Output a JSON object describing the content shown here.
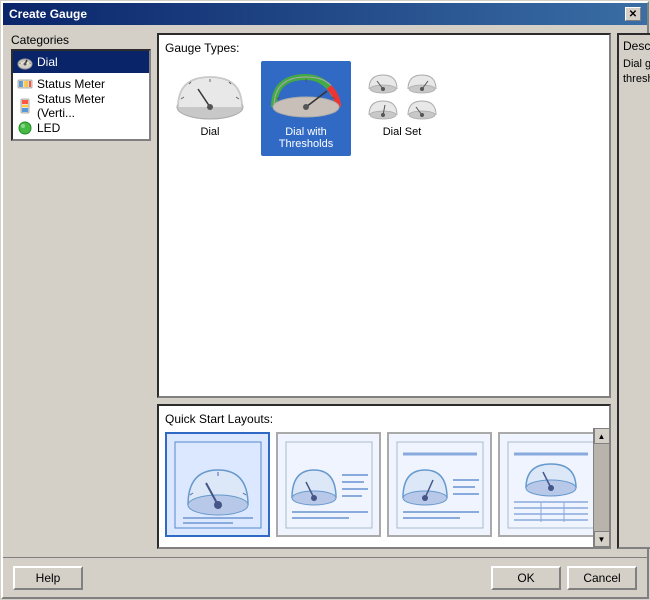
{
  "dialog": {
    "title": "Create Gauge",
    "close_btn": "✕"
  },
  "categories": {
    "label": "Categories",
    "items": [
      {
        "id": "dial",
        "label": "Dial",
        "selected": true,
        "icon": "dial"
      },
      {
        "id": "status-meter",
        "label": "Status Meter",
        "selected": false,
        "icon": "bar"
      },
      {
        "id": "status-meter-verti",
        "label": "Status Meter (Verti...",
        "selected": false,
        "icon": "bar-vert"
      },
      {
        "id": "led",
        "label": "LED",
        "selected": false,
        "icon": "circle"
      }
    ]
  },
  "gauge_types": {
    "label": "Gauge Types:",
    "items": [
      {
        "id": "dial",
        "label": "Dial",
        "selected": false
      },
      {
        "id": "dial-with-thresholds",
        "label": "Dial\nwith Thresholds",
        "selected": true
      },
      {
        "id": "dial-set",
        "label": "Dial Set",
        "selected": false
      }
    ]
  },
  "quick_start": {
    "label": "Quick Start Layouts:",
    "items": [
      {
        "id": "layout-1",
        "selected": true
      },
      {
        "id": "layout-2",
        "selected": false
      },
      {
        "id": "layout-3",
        "selected": false
      },
      {
        "id": "layout-4",
        "selected": false
      }
    ]
  },
  "description": {
    "label": "Description",
    "text": "Dial gauge with thresholds."
  },
  "footer": {
    "help_label": "Help",
    "ok_label": "OK",
    "cancel_label": "Cancel"
  }
}
